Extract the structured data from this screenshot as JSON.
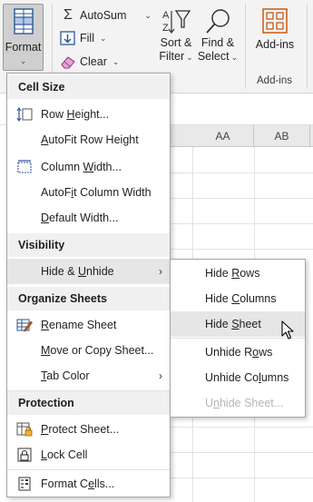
{
  "ribbon": {
    "format": {
      "label": "Format",
      "chevron": "⌄"
    },
    "autosum": {
      "label": "AutoSum",
      "chevron": "⌄",
      "icon": "sigma-icon"
    },
    "fill": {
      "label": "Fill",
      "chevron": "⌄",
      "icon": "fill-down-icon"
    },
    "clear": {
      "label": "Clear",
      "chevron": "⌄",
      "icon": "eraser-icon"
    },
    "sort_filter": {
      "line1": "Sort &",
      "line2": "Filter",
      "chevron": "⌄",
      "icon": "sort-filter-icon"
    },
    "find_select": {
      "line1": "Find &",
      "line2": "Select",
      "chevron": "⌄",
      "icon": "magnifier-icon"
    },
    "addins": {
      "label": "Add-ins",
      "group_label": "Add-ins",
      "icon": "addins-grid-icon"
    },
    "accent_color": "#c55a11"
  },
  "grid": {
    "columns": [
      "AA",
      "AB"
    ]
  },
  "format_menu": {
    "sections": {
      "cell_size": "Cell Size",
      "visibility": "Visibility",
      "organize": "Organize Sheets",
      "protection": "Protection"
    },
    "items": {
      "row_height": {
        "pre": "Row ",
        "key": "H",
        "post": "eight..."
      },
      "autofit_row": {
        "pre": "",
        "key": "A",
        "post": "utoFit Row Height"
      },
      "column_width": {
        "pre": "Column ",
        "key": "W",
        "post": "idth..."
      },
      "autofit_column": {
        "pre": "AutoF",
        "key": "i",
        "post": "t Column Width"
      },
      "default_width": {
        "pre": "",
        "key": "D",
        "post": "efault Width..."
      },
      "hide_unhide": {
        "pre": "Hide & ",
        "key": "U",
        "post": "nhide"
      },
      "rename_sheet": {
        "pre": "",
        "key": "R",
        "post": "ename Sheet"
      },
      "move_copy": {
        "pre": "",
        "key": "M",
        "post": "ove or Copy Sheet..."
      },
      "tab_color": {
        "pre": "",
        "key": "T",
        "post": "ab Color"
      },
      "protect_sheet": {
        "pre": "",
        "key": "P",
        "post": "rotect Sheet..."
      },
      "lock_cell": {
        "pre": "",
        "key": "L",
        "post": "ock Cell"
      },
      "format_cells": {
        "pre": "Format C",
        "key": "e",
        "post": "lls..."
      }
    },
    "submenu_arrow": "›"
  },
  "hide_unhide_submenu": {
    "hide_rows": {
      "pre": "Hide ",
      "key": "R",
      "post": "ows"
    },
    "hide_columns": {
      "pre": "Hide ",
      "key": "C",
      "post": "olumns"
    },
    "hide_sheet": {
      "pre": "Hide ",
      "key": "S",
      "post": "heet"
    },
    "unhide_rows": {
      "pre": "Unhide R",
      "key": "o",
      "post": "ws"
    },
    "unhide_columns": {
      "pre": "Unhide Co",
      "key": "l",
      "post": "umns"
    },
    "unhide_sheet": {
      "pre": "U",
      "key": "n",
      "post": "hide Sheet..."
    }
  }
}
